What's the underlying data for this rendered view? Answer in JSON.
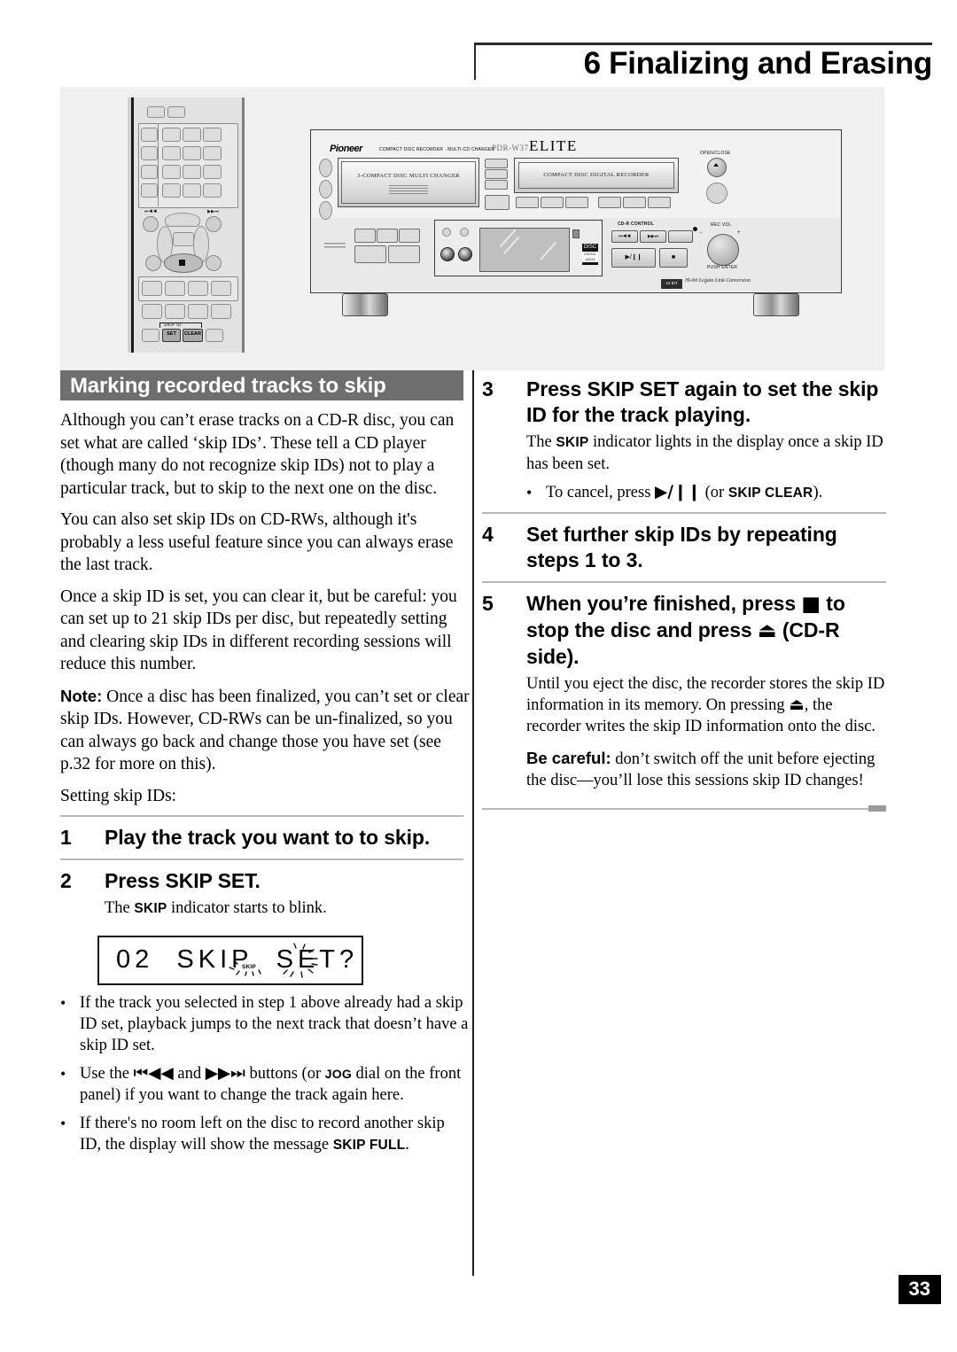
{
  "header": {
    "chapter_title": "6 Finalizing and Erasing"
  },
  "illustration": {
    "alt": "Pioneer Elite PDR-W37 CD recorder / multi-CD changer with remote control",
    "remote": {
      "skip_id_label": "SKIP ID",
      "set_button": "SET",
      "clear_button": "CLEAR",
      "prev_icon": "skip-back-icon",
      "next_icon": "skip-forward-icon",
      "stop_icon": "stop-icon"
    },
    "deck": {
      "brand": "Pioneer",
      "brand_sub": "COMPACT DISC RECORDER · MULTI-CD CHANGER",
      "model": "PDR-W37",
      "series": "ELITE",
      "changer_tray": "3-COMPACT DISC MULTI CHANGER",
      "recorder_tray": "COMPACT DISC DIGITAL RECORDER",
      "open_close": "OPEN/CLOSE",
      "eject_icon": "eject-icon",
      "cdr_control": "CD-R CONTROL",
      "rec_vol": "REC VOL",
      "push_enter": "PUSH ENTER",
      "play_pause": "▶/❙❙",
      "stop": "■",
      "prev": "⏮◀◀",
      "next": "▶▶⏭",
      "disc_logo": "DIGITAL AUDIO",
      "hibit": "Hi-bit Legato Link Conversion",
      "hibit_badge": "24 BIT"
    }
  },
  "left_column": {
    "section_title": "Marking recorded tracks to skip",
    "paragraphs": [
      "Although you can’t erase tracks on a CD-R disc, you can set what are called ‘skip IDs’. These tell a CD player (though many do not recognize skip IDs) not to play a particular track, but to skip to the next one on the disc.",
      "You can also set skip IDs on CD-RWs, although it's probably a less useful feature since you can always erase the last track.",
      "Once a skip ID is set, you can clear it, but be careful: you can set up to 21 skip IDs per disc, but repeatedly setting and clearing skip IDs in different recording sessions will reduce this number."
    ],
    "note_label": "Note:",
    "note_text": " Once a disc has been finalized, you can’t set or clear skip IDs. However, CD-RWs can be un-finalized, so you can always go back and change those you have set (see p.32 for more on this).",
    "lead_in": "Setting skip IDs:",
    "steps": [
      {
        "num": "1",
        "title": "Play the track you want to to skip."
      },
      {
        "num": "2",
        "title": "Press SKIP SET.",
        "note_pre": "The ",
        "note_sc": "SKIP",
        "note_post": " indicator starts to blink."
      }
    ],
    "lcd": {
      "track": "02",
      "message": "SKIP",
      "prompt": "SET?",
      "indicator": "SKIP"
    },
    "bullets": [
      {
        "pre": "If the track you selected in step 1 above already had a skip ID set, playback jumps to the next track that doesn’t have a skip ID set."
      },
      {
        "pre": "Use the ",
        "icon1": "⏮◀◀",
        "mid": " and ",
        "icon2": "▶▶⏭",
        "post": " buttons (or ",
        "sc": "JOG",
        "post2": " dial on the front panel) if you want to change the track again here."
      },
      {
        "pre": "If there's no room left on the disc to record another skip ID, the display will show the message ",
        "sc": "SKIP FULL",
        "post": "."
      }
    ]
  },
  "right_column": {
    "steps": [
      {
        "num": "3",
        "title": "Press SKIP SET again to set the skip ID for the track playing.",
        "note_pre": "The ",
        "note_sc": "SKIP",
        "note_post": " indicator lights in the display once a skip ID has been set.",
        "bullet_pre": "To cancel, press ",
        "bullet_icon": "▶/❙❙",
        "bullet_mid": " (or ",
        "bullet_sc": "SKIP CLEAR",
        "bullet_post": ")."
      },
      {
        "num": "4",
        "title": "Set further skip IDs by repeating steps 1 to 3."
      },
      {
        "num": "5",
        "title_pre": "When you’re finished, press ",
        "title_icon1": "■",
        "title_mid": " to stop the disc and press ",
        "title_icon2": "⏏",
        "title_post": " (CD-R side).",
        "note_pre": "Until you eject the disc, the recorder stores the skip ID information in its memory. On pressing ",
        "note_icon": "⏏",
        "note_post": ", the recorder writes the skip ID information onto the disc.",
        "warn_label": "Be careful:",
        "warn_text": " don’t switch off the unit before ejecting the disc—you’ll lose this sessions skip ID changes!"
      }
    ]
  },
  "footer": {
    "page_number": "33"
  },
  "colors": {
    "section_bar": "#6e6e6e",
    "rule": "#b9b9b9",
    "divider": "#1f1f1f",
    "page_badge": "#000000",
    "illustration_bg": "#f0f0f0"
  }
}
